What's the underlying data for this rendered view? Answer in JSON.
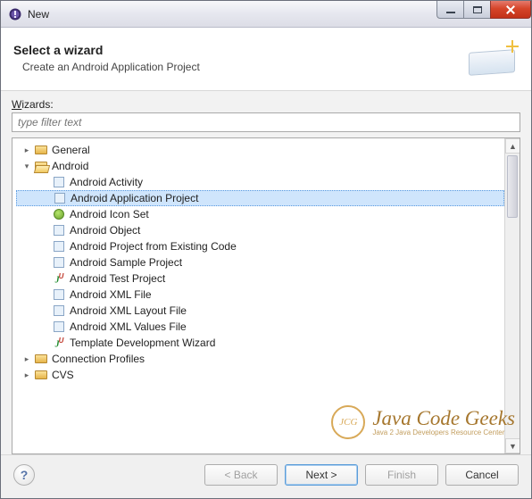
{
  "window": {
    "title": "New"
  },
  "header": {
    "title": "Select a wizard",
    "subtitle": "Create an Android Application Project"
  },
  "filter": {
    "label_pre": "W",
    "label_rest": "izards:",
    "placeholder": "type filter text"
  },
  "tree": [
    {
      "label": "General",
      "depth": 1,
      "icon": "folder",
      "expanded": false
    },
    {
      "label": "Android",
      "depth": 1,
      "icon": "folder-open",
      "expanded": true,
      "children": [
        {
          "label": "Android Activity",
          "icon": "generic"
        },
        {
          "label": "Android Application Project",
          "icon": "generic",
          "selected": true
        },
        {
          "label": "Android Icon Set",
          "icon": "android"
        },
        {
          "label": "Android Object",
          "icon": "generic"
        },
        {
          "label": "Android Project from Existing Code",
          "icon": "generic"
        },
        {
          "label": "Android Sample Project",
          "icon": "generic"
        },
        {
          "label": "Android Test Project",
          "icon": "ju"
        },
        {
          "label": "Android XML File",
          "icon": "generic"
        },
        {
          "label": "Android XML Layout File",
          "icon": "generic"
        },
        {
          "label": "Android XML Values File",
          "icon": "generic"
        },
        {
          "label": "Template Development Wizard",
          "icon": "ju"
        }
      ]
    },
    {
      "label": "Connection Profiles",
      "depth": 1,
      "icon": "folder",
      "expanded": false
    },
    {
      "label": "CVS",
      "depth": 1,
      "icon": "folder",
      "expanded": false
    }
  ],
  "watermark": {
    "badge": "JCG",
    "title": "Java Code Geeks",
    "tagline": "Java 2 Java Developers Resource Center"
  },
  "footer": {
    "back": "< Back",
    "next": "Next >",
    "finish": "Finish",
    "cancel": "Cancel"
  }
}
